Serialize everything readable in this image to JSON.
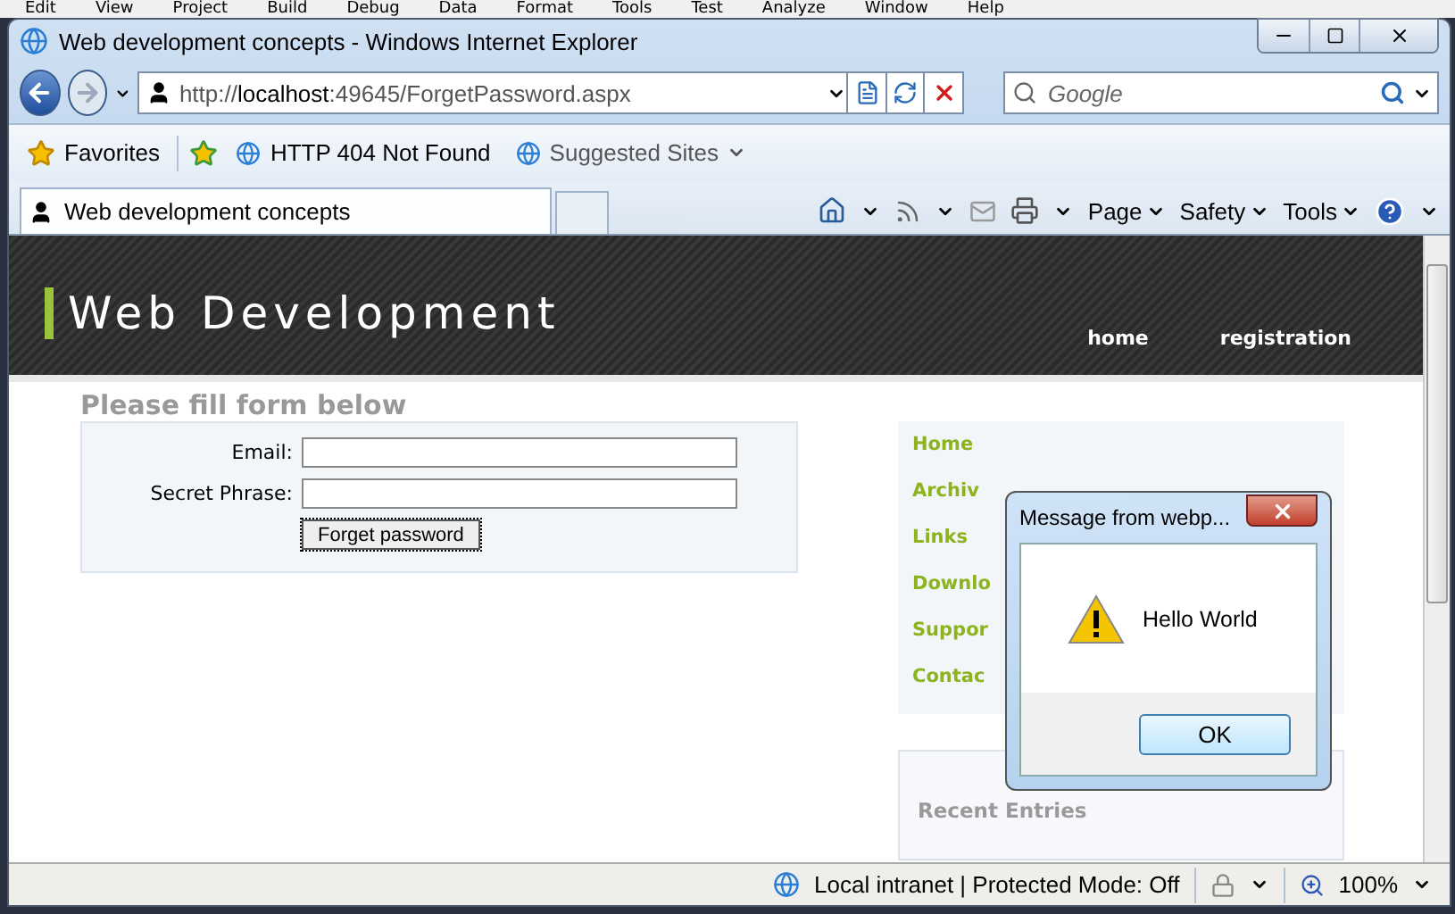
{
  "ide_menu": [
    "Edit",
    "View",
    "Project",
    "Build",
    "Debug",
    "Data",
    "Format",
    "Tools",
    "Test",
    "Analyze",
    "Window",
    "Help"
  ],
  "window": {
    "title": "Web development concepts - Windows Internet Explorer"
  },
  "address_bar": {
    "url": "http://**localhost**:49645/ForgetPassword.aspx"
  },
  "search": {
    "placeholder": "Google"
  },
  "favorites_bar": {
    "favorites": "Favorites",
    "links": [
      "HTTP 404 Not Found",
      "Suggested Sites"
    ]
  },
  "tabs": [
    {
      "label": "Web development concepts",
      "selected": true
    }
  ],
  "command_bar": [
    "Page",
    "Safety",
    "Tools"
  ],
  "page": {
    "site_title": "Web Development",
    "nav": [
      "home",
      "registration"
    ],
    "form_heading": "Please fill form below",
    "fields": [
      {
        "label": "Email:"
      },
      {
        "label": "Secret Phrase:"
      }
    ],
    "submit": "Forget password",
    "sidebar_links": [
      "Home",
      "Archiv",
      "Links",
      "Downlo",
      "Suppor",
      "Contac"
    ],
    "recent_heading": "Recent Entries"
  },
  "dialog": {
    "title": "Message from webp...",
    "message": "Hello World",
    "button": "OK"
  },
  "status_bar": {
    "zone": "Local intranet | Protected Mode: Off",
    "zoom": "100%"
  }
}
